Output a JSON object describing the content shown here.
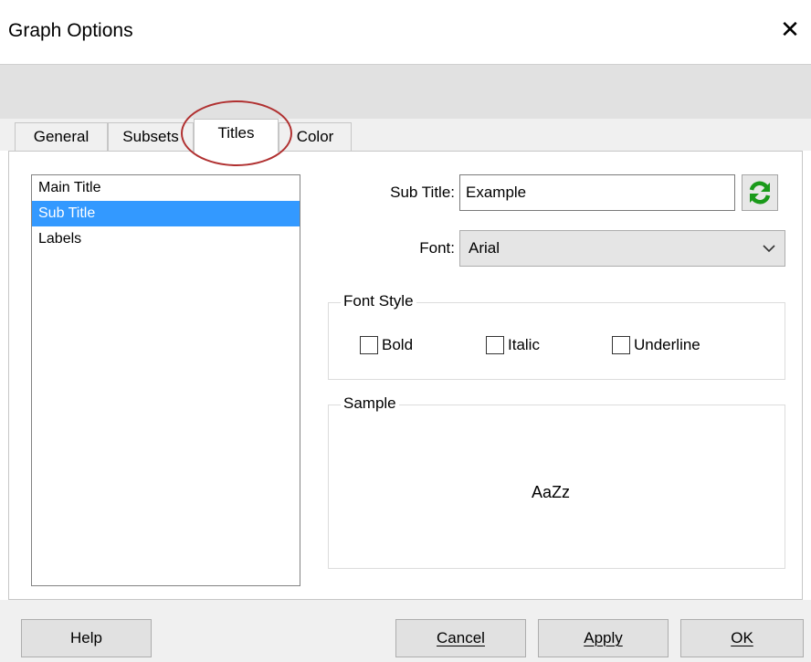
{
  "window": {
    "title": "Graph Options",
    "close_glyph": "✕"
  },
  "tabs": [
    {
      "label": "General",
      "active": false
    },
    {
      "label": "Subsets",
      "active": false
    },
    {
      "label": "Titles",
      "active": true
    },
    {
      "label": "Color",
      "active": false
    }
  ],
  "title_list": {
    "items": [
      {
        "label": "Main Title",
        "selected": false
      },
      {
        "label": "Sub Title",
        "selected": true
      },
      {
        "label": "Labels",
        "selected": false
      }
    ]
  },
  "subtitle": {
    "label": "Sub Title:",
    "value": "Example",
    "refresh_icon": "refresh-icon"
  },
  "font": {
    "label": "Font:",
    "value": "Arial"
  },
  "font_style": {
    "label": "Font Style",
    "bold": {
      "label": "Bold",
      "checked": false
    },
    "italic": {
      "label": "Italic",
      "checked": false
    },
    "underline": {
      "label": "Underline",
      "checked": false
    }
  },
  "sample": {
    "label": "Sample",
    "text": "AaZz"
  },
  "buttons": {
    "help": "Help",
    "cancel": "Cancel",
    "apply": "Apply",
    "ok": "OK"
  },
  "colors": {
    "selection": "#3399ff",
    "annotation": "#b03030",
    "refresh_icon": "#1a9a1a"
  }
}
